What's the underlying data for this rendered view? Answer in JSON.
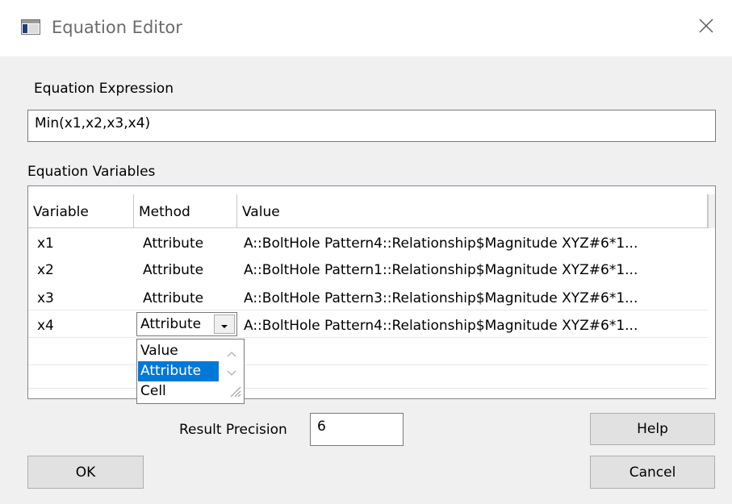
{
  "window": {
    "title": "Equation Editor"
  },
  "expression": {
    "label": "Equation Expression",
    "value": "Min(x1,x2,x3,x4)"
  },
  "variables": {
    "label": "Equation Variables",
    "columns": [
      "Variable",
      "Method",
      "Value"
    ],
    "rows": [
      {
        "variable": "x1",
        "method": "Attribute",
        "value": "A::BoltHole Pattern4::Relationship$Magnitude XYZ#6*1..."
      },
      {
        "variable": "x2",
        "method": "Attribute",
        "value": "A::BoltHole Pattern1::Relationship$Magnitude XYZ#6*1..."
      },
      {
        "variable": "x3",
        "method": "Attribute",
        "value": "A::BoltHole Pattern3::Relationship$Magnitude XYZ#6*1..."
      },
      {
        "variable": "x4",
        "method": "Attribute",
        "value": "A::BoltHole Pattern4::Relationship$Magnitude XYZ#6*1..."
      }
    ],
    "method_dropdown": {
      "selected": "Attribute",
      "options": [
        "Value",
        "Attribute",
        "Cell"
      ]
    }
  },
  "precision": {
    "label": "Result Precision",
    "value": "6"
  },
  "buttons": {
    "help": "Help",
    "ok": "OK",
    "cancel": "Cancel"
  },
  "colors": {
    "selection": "#0078d7",
    "dialog_bg": "#f0f0f0",
    "button_bg": "#e1e1e1"
  },
  "icons": {
    "app": "window-icon",
    "close": "close-icon",
    "dropdown": "chevron-down-icon",
    "resize": "resize-grip-icon"
  }
}
